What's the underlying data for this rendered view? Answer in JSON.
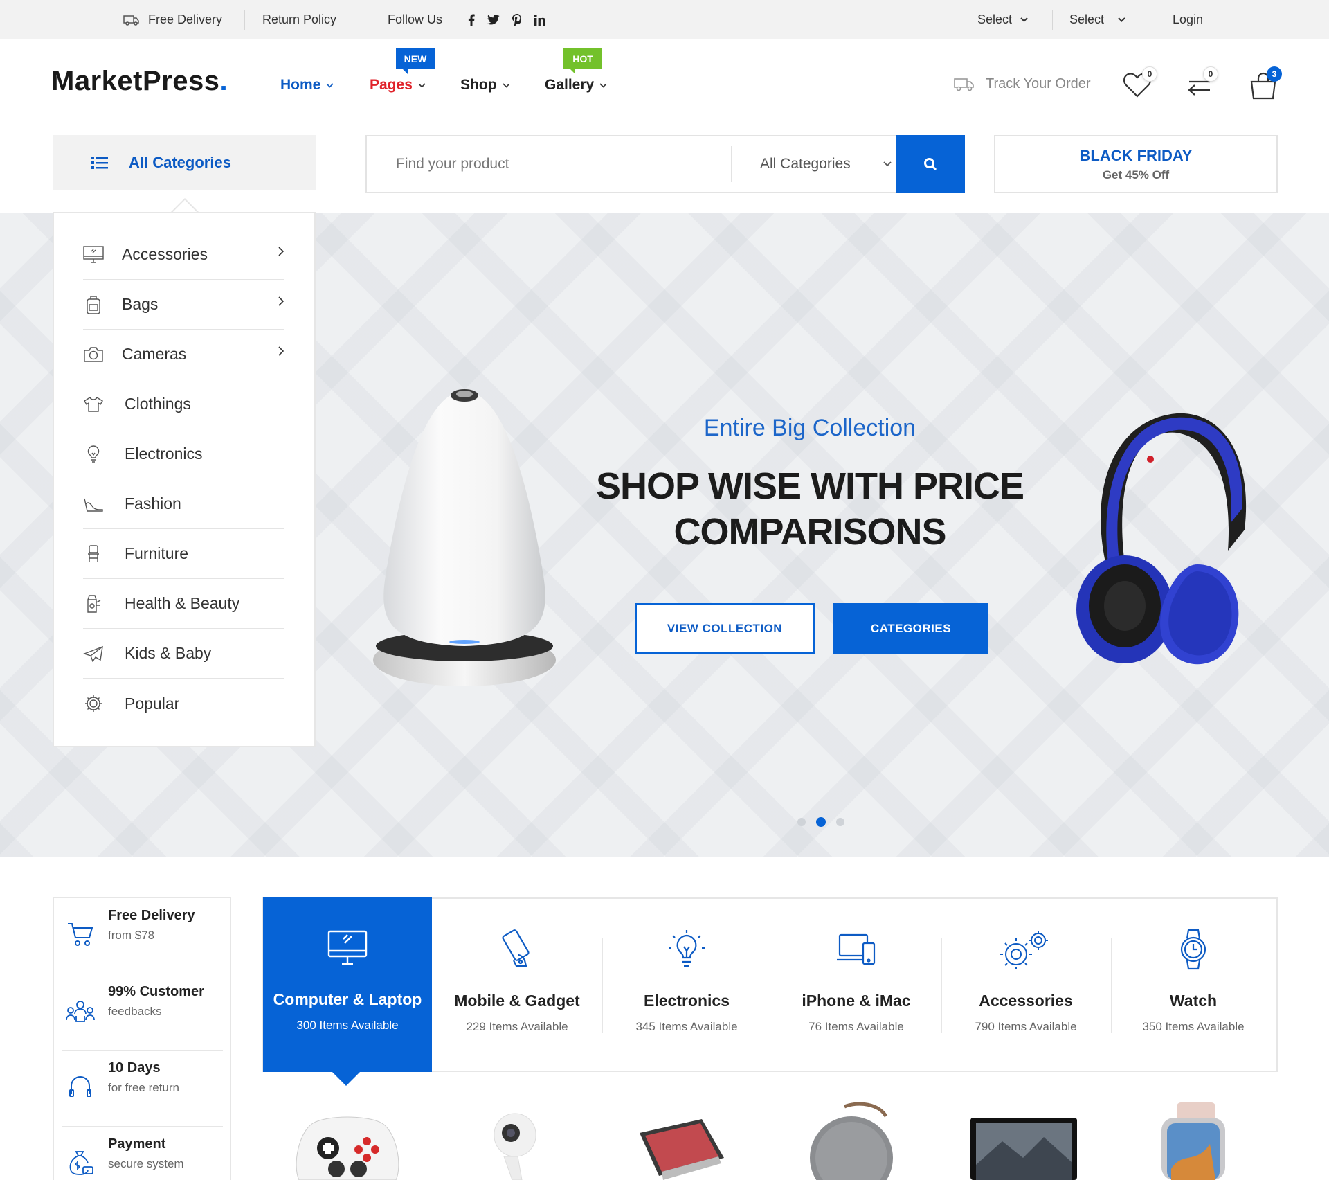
{
  "topbar": {
    "free_delivery": "Free Delivery",
    "return_policy": "Return Policy",
    "follow_us": "Follow Us",
    "social": [
      "facebook-icon",
      "twitter-icon",
      "pinterest-icon",
      "linkedin-icon"
    ],
    "select_1": "Select",
    "select_2": "Select",
    "login": "Login"
  },
  "header": {
    "logo_text": "MarketPress",
    "logo_dot": ".",
    "nav": [
      {
        "label": "Home",
        "badge": ""
      },
      {
        "label": "Pages",
        "badge": "NEW"
      },
      {
        "label": "Shop",
        "badge": ""
      },
      {
        "label": "Gallery",
        "badge": "HOT"
      }
    ],
    "track_order": "Track Your Order",
    "wishlist_count": "0",
    "compare_count": "0",
    "cart_count": "3"
  },
  "search": {
    "all_categories_button": "All Categories",
    "placeholder": "Find your product",
    "category_select": "All Categories"
  },
  "promo": {
    "title": "BLACK FRIDAY",
    "subtitle": "Get 45% Off"
  },
  "category_menu": [
    {
      "label": "Accessories",
      "icon": "monitor-icon",
      "has_submenu": true
    },
    {
      "label": "Bags",
      "icon": "backpack-icon",
      "has_submenu": true
    },
    {
      "label": "Cameras",
      "icon": "camera-icon",
      "has_submenu": true
    },
    {
      "label": "Clothings",
      "icon": "tshirt-icon",
      "has_submenu": false
    },
    {
      "label": "Electronics",
      "icon": "lightbulb-icon",
      "has_submenu": false
    },
    {
      "label": "Fashion",
      "icon": "high-heel-icon",
      "has_submenu": false
    },
    {
      "label": "Furniture",
      "icon": "chair-icon",
      "has_submenu": false
    },
    {
      "label": "Health & Beauty",
      "icon": "beauty-icon",
      "has_submenu": false
    },
    {
      "label": "Kids & Baby",
      "icon": "paper-plane-icon",
      "has_submenu": false
    },
    {
      "label": "Popular",
      "icon": "gear-icon",
      "has_submenu": false
    }
  ],
  "hero": {
    "subtitle": "Entire Big Collection",
    "title_line1": "SHOP WISE WITH PRICE",
    "title_line2": "COMPARISONS",
    "button_primary": "VIEW COLLECTION",
    "button_secondary": "CATEGORIES",
    "slides_total": 3,
    "slide_active": 2
  },
  "features": [
    {
      "title": "Free Delivery",
      "subtitle": "from $78",
      "icon": "cart-icon"
    },
    {
      "title": "99% Customer",
      "subtitle": "feedbacks",
      "icon": "customers-icon"
    },
    {
      "title": "10 Days",
      "subtitle": "for free return",
      "icon": "headphones-icon"
    },
    {
      "title": "Payment",
      "subtitle": "secure system",
      "icon": "money-bag-icon"
    }
  ],
  "categories": [
    {
      "name": "Computer & Laptop",
      "count": "300 Items Available",
      "icon": "computer-icon",
      "active": true
    },
    {
      "name": "Mobile & Gadget",
      "count": "229 Items Available",
      "icon": "mobile-icon",
      "active": false
    },
    {
      "name": "Electronics",
      "count": "345 Items Available",
      "icon": "bulb-icon",
      "active": false
    },
    {
      "name": "iPhone & iMac",
      "count": "76 Items Available",
      "icon": "devices-icon",
      "active": false
    },
    {
      "name": "Accessories",
      "count": "790 Items Available",
      "icon": "gears-icon",
      "active": false
    },
    {
      "name": "Watch",
      "count": "350 Items Available",
      "icon": "watch-icon",
      "active": false
    }
  ],
  "products": [
    "gamepad-image",
    "camera-image",
    "tablet-image",
    "speaker-image",
    "laptop-image",
    "smartwatch-image"
  ],
  "colors": {
    "brand_blue": "#0663d6",
    "hot_green": "#73c12b",
    "nav_red": "#e0222a",
    "topbar_bg": "#f2f2f2"
  }
}
